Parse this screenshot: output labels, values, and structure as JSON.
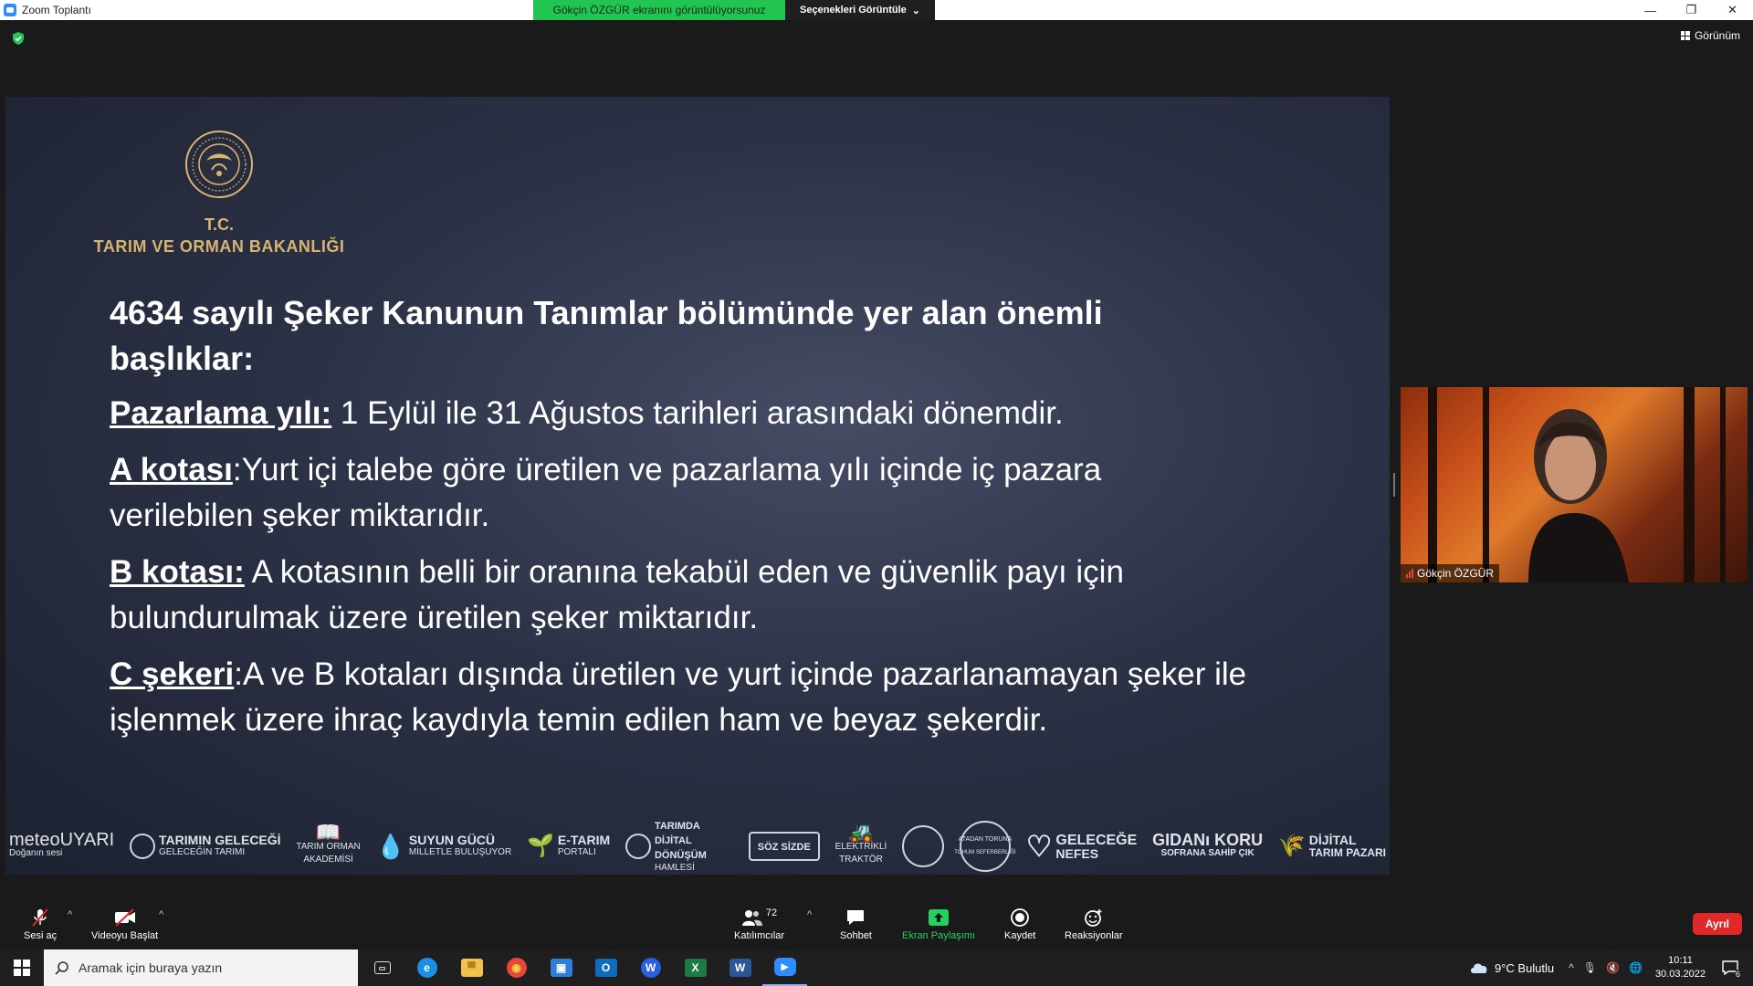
{
  "window": {
    "title": "Zoom Toplantı"
  },
  "share_banner": {
    "message": "Gökçin ÖZGÜR ekranını görüntülüyorsunuz",
    "options_label": "Seçenekleri Görüntüle"
  },
  "view_button": {
    "label": "Görünüm"
  },
  "slide": {
    "org_line1": "T.C.",
    "org_line2": "TARIM VE ORMAN BAKANLIĞI",
    "heading": "4634 sayılı Şeker Kanunun Tanımlar bölümünde yer alan önemli başlıklar:",
    "items": [
      {
        "term": "Pazarlama yılı:",
        "text": " 1 Eylül ile 31 Ağustos tarihleri arasındaki dönemdir."
      },
      {
        "term": "A kotası",
        "text": ":Yurt içi talebe göre üretilen ve pazarlama yılı içinde iç pazara verilebilen şeker miktarıdır."
      },
      {
        "term": "B kotası:",
        "text": " A kotasının belli bir oranına tekabül eden ve güvenlik payı için bulundurulmak üzere üretilen şeker miktarıdır."
      },
      {
        "term": "C şekeri",
        "text": ":A ve B kotaları dışında üretilen ve yurt içinde pazarlanamayan şeker ile işlenmek üzere ihraç kaydıyla temin edilen ham ve beyaz şekerdir."
      }
    ],
    "logos": [
      {
        "name": "meteoUYARI",
        "sub": "Doğanın sesi"
      },
      {
        "name": "TARIMIN GELECEĞİ",
        "sub": "GELECEĞİN TARIMI"
      },
      {
        "name": "TARIM ORMAN",
        "sub": "AKADEMİSİ"
      },
      {
        "name": "SUYUN GÜCÜ",
        "sub": "MİLLETLE BULUŞUYOR"
      },
      {
        "name": "E-TARIM",
        "sub": "PORTALI"
      },
      {
        "name": "TARIMDA DİJİTAL DÖNÜŞÜM",
        "sub": "HAMLESİ"
      },
      {
        "name": "SÖZ SİZDE",
        "sub": ""
      },
      {
        "name": "ELEKTRİKLİ",
        "sub": "TRAKTÖR"
      },
      {
        "name": "",
        "sub": ""
      },
      {
        "name": "ATADAN TORUNA",
        "sub": "TOHUM SEFERBERLİĞİ"
      },
      {
        "name": "GELECEĞE",
        "sub": "NEFES"
      },
      {
        "name": "GIDANı KORU",
        "sub": "SOFRANA SAHİP ÇIK"
      },
      {
        "name": "DİJİTAL",
        "sub": "TARIM PAZARI"
      }
    ]
  },
  "participant": {
    "name": "Gökçin ÖZGÜR"
  },
  "controls": {
    "audio_label": "Sesi aç",
    "video_label": "Videoyu Başlat",
    "participants_label": "Katılımcılar",
    "participants_count": "72",
    "chat_label": "Sohbet",
    "share_label": "Ekran Paylaşımı",
    "record_label": "Kaydet",
    "reactions_label": "Reaksiyonlar",
    "leave_label": "Ayrıl"
  },
  "taskbar": {
    "search_placeholder": "Aramak için buraya yazın",
    "weather": "9°C  Bulutlu",
    "time": "10:11",
    "date": "30.03.2022",
    "notification_count": "6",
    "apps": [
      {
        "icon": "task-view-icon",
        "color": "#1f1f1f",
        "glyph": "▭"
      },
      {
        "icon": "edge-icon",
        "color": "#1a8fe3",
        "glyph": "e"
      },
      {
        "icon": "file-explorer-icon",
        "color": "#f2c14e",
        "glyph": "▀"
      },
      {
        "icon": "chrome-icon",
        "color": "#e8453c",
        "glyph": "◉"
      },
      {
        "icon": "store-icon",
        "color": "#2f7fd8",
        "glyph": "▣"
      },
      {
        "icon": "outlook-icon",
        "color": "#0f6cbd",
        "glyph": "O"
      },
      {
        "icon": "webex-icon",
        "color": "#2b5fe0",
        "glyph": "W"
      },
      {
        "icon": "excel-icon",
        "color": "#1d7a45",
        "glyph": "X"
      },
      {
        "icon": "word-icon",
        "color": "#2b5797",
        "glyph": "W"
      },
      {
        "icon": "zoom-icon",
        "color": "#2d8cff",
        "glyph": "▶"
      }
    ]
  }
}
